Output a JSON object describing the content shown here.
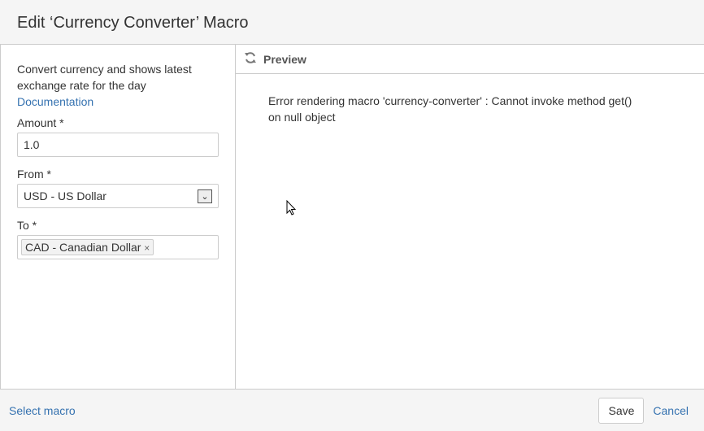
{
  "dialog": {
    "title": "Edit ‘Currency Converter’ Macro"
  },
  "form": {
    "description": "Convert currency and shows latest exchange rate for the day",
    "documentation_link": "Documentation",
    "amount_label": "Amount *",
    "amount_value": "1.0",
    "from_label": "From *",
    "from_value": "USD - US Dollar",
    "to_label": "To *",
    "to_tags": [
      "CAD - Canadian Dollar"
    ],
    "tag_remove": "×"
  },
  "preview": {
    "title": "Preview",
    "error": "Error rendering macro 'currency-converter' : Cannot invoke method get() on null object"
  },
  "footer": {
    "select_macro": "Select macro",
    "save": "Save",
    "cancel": "Cancel"
  }
}
